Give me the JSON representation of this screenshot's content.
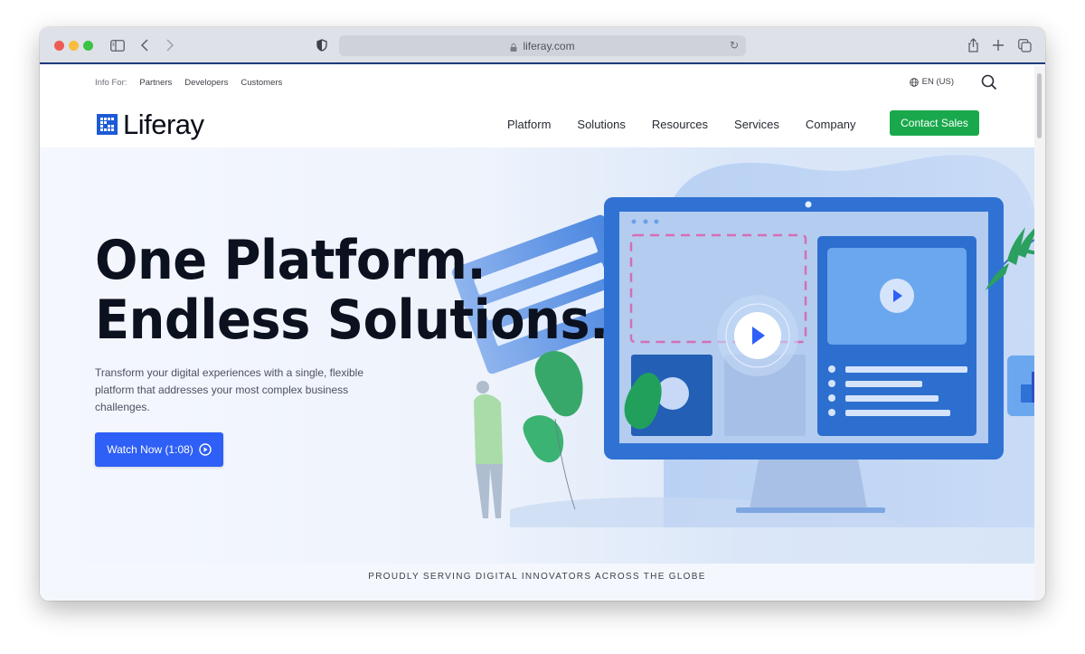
{
  "browser": {
    "url": "liferay.com",
    "icons": [
      "sidebar-icon",
      "back-icon",
      "forward-icon",
      "privacy-shield-icon",
      "lock-icon",
      "reload-icon",
      "share-icon",
      "new-tab-icon",
      "tabs-overview-icon"
    ]
  },
  "header": {
    "info_for_label": "Info For:",
    "info_links": [
      "Partners",
      "Developers",
      "Customers"
    ],
    "language": "EN (US)",
    "logo_text": "Liferay",
    "nav": [
      "Platform",
      "Solutions",
      "Resources",
      "Services",
      "Company"
    ],
    "cta": "Contact Sales"
  },
  "hero": {
    "title_line1": "One Platform.",
    "title_line2": "Endless Solutions.",
    "subtitle": "Transform your digital experiences with a single, flexible platform that addresses your most complex business challenges.",
    "button": "Watch Now (1:08)"
  },
  "strap": "PROUDLY SERVING DIGITAL INNOVATORS ACROSS THE GLOBE",
  "colors": {
    "brand_blue": "#1c5ad6",
    "cta_green": "#19a94c",
    "button_blue": "#2e5ff6",
    "heading": "#0b111e"
  }
}
